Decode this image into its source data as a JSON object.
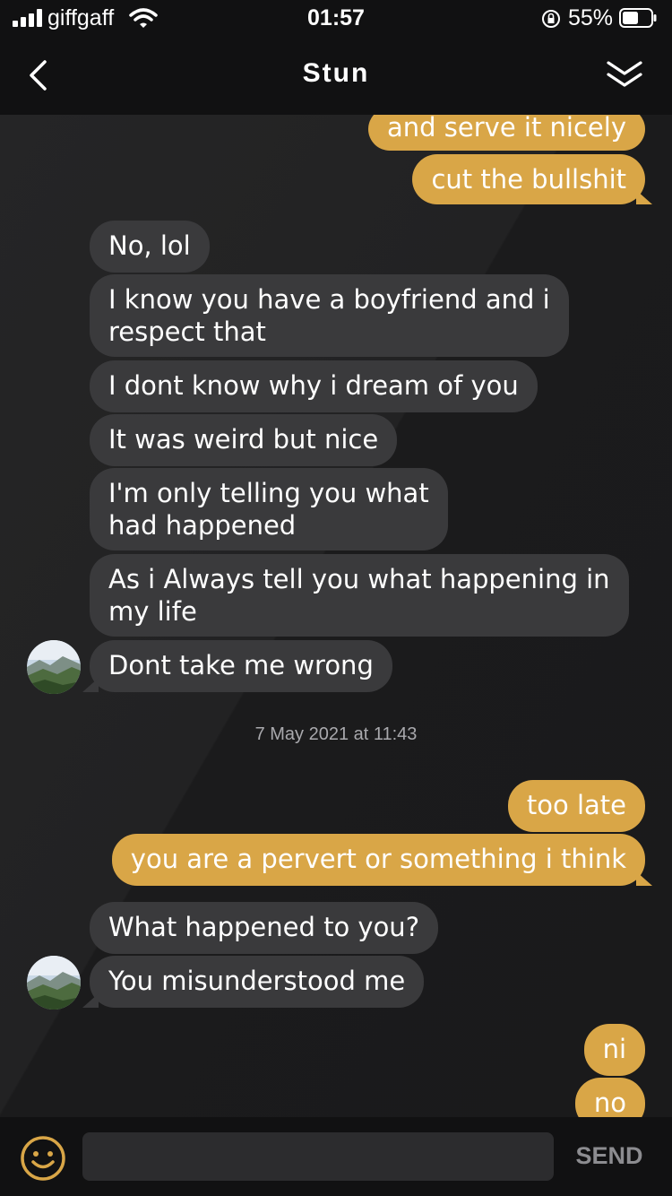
{
  "status_bar": {
    "carrier": "giffgaff",
    "time": "01:57",
    "battery": "55%"
  },
  "header": {
    "title": "Stun",
    "back_icon": "chevron-left-icon",
    "collapse_icon": "double-chevron-down-icon"
  },
  "messages": [
    {
      "from": "me",
      "text": "and serve it nicely"
    },
    {
      "from": "me",
      "text": "cut the bullshit"
    },
    {
      "from": "them",
      "text": "No, lol"
    },
    {
      "from": "them",
      "lines": [
        "I know you have a boyfriend and i",
        "respect that"
      ]
    },
    {
      "from": "them",
      "text": "I dont know why i dream of you"
    },
    {
      "from": "them",
      "text": "It was weird but nice"
    },
    {
      "from": "them",
      "lines": [
        "I'm only telling you what",
        "had happened"
      ]
    },
    {
      "from": "them",
      "lines": [
        "As i Always tell you what happening in",
        "my life"
      ]
    },
    {
      "from": "them",
      "text": "Dont take me wrong"
    },
    {
      "from": "me",
      "text": "too late"
    },
    {
      "from": "me",
      "text": "you are a pervert or something i think"
    },
    {
      "from": "them",
      "text": "What happened to you?"
    },
    {
      "from": "them",
      "text": "You misunderstood me"
    },
    {
      "from": "me",
      "text": "ni"
    },
    {
      "from": "me",
      "text": "no"
    }
  ],
  "timestamp": "7 May 2021 at 11:43",
  "composer": {
    "value": "",
    "send_label": "SEND",
    "emoji_icon": "smiley-icon"
  },
  "colors": {
    "outgoing": "#d9a647",
    "incoming": "#3a3a3c",
    "background": "#1f1f20",
    "bar": "#111112"
  }
}
